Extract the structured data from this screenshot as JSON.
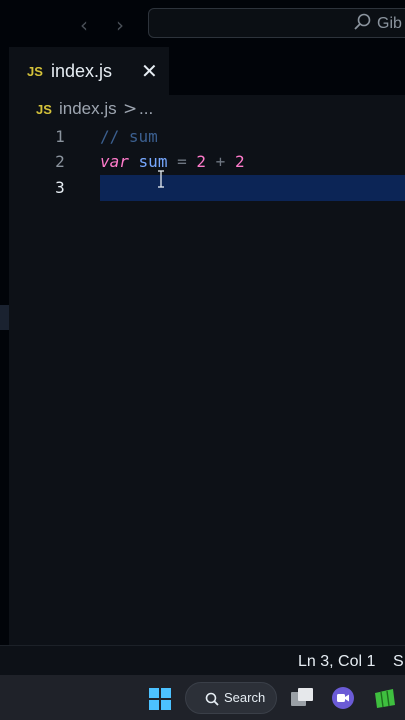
{
  "titlebar": {
    "search_text": "Gib",
    "back_icon": "chevron-left-icon",
    "forward_icon": "chevron-right-icon"
  },
  "tabs": [
    {
      "badge": "JS",
      "label": "index.js",
      "close": "✕"
    }
  ],
  "breadcrumb": {
    "badge": "JS",
    "file": "index.js",
    "separator": ">",
    "more": "..."
  },
  "editor": {
    "lines": [
      {
        "number": "1",
        "tokens": [
          "// sum"
        ]
      },
      {
        "number": "2",
        "tokens": [
          "var",
          "sum",
          "=",
          "2",
          "+",
          "2"
        ]
      },
      {
        "number": "3",
        "tokens": []
      }
    ],
    "current_line": 3
  },
  "statusbar": {
    "position": "Ln 3, Col 1",
    "encoding": "S"
  },
  "taskbar": {
    "search_label": "Search",
    "apps": [
      "windows-start-icon",
      "task-view-icon",
      "video-call-icon",
      "spreadsheet-app-icon"
    ]
  },
  "colors": {
    "background": "#0d1117",
    "current_line": "#0c2556",
    "keyword": "#ff7bcb",
    "variable": "#77a8ff",
    "comment": "#3b5f8f",
    "js_badge": "#d4c23a"
  }
}
